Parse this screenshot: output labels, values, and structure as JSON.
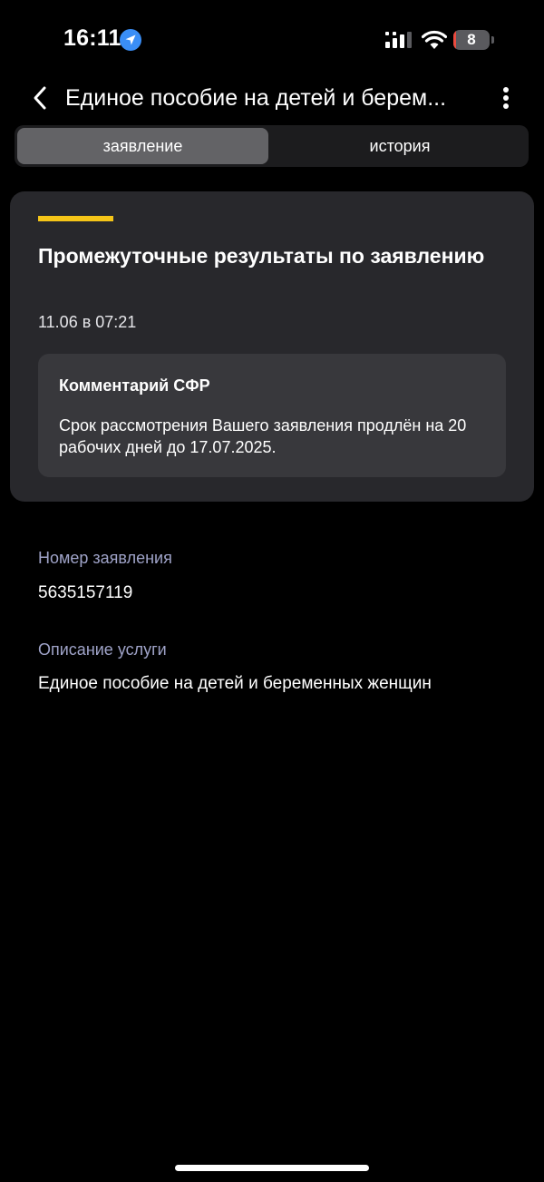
{
  "status_bar": {
    "time": "16:11",
    "battery_level": "8",
    "battery_percent": 8
  },
  "header": {
    "title": "Единое пособие на детей и берем...",
    "back_icon": "chevron-left-icon",
    "more_icon": "vertical-dots-icon"
  },
  "tabs": [
    {
      "label": "заявление",
      "active": true
    },
    {
      "label": "история",
      "active": false
    }
  ],
  "status_card": {
    "accent_color": "#f5c518",
    "title": "Промежуточные результаты по заявлению",
    "date": "11.06 в 07:21",
    "comment": {
      "title": "Комментарий СФР",
      "text": "Срок рассмотрения Вашего заявления продлён на 20 рабочих дней до 17.07.2025."
    }
  },
  "details": [
    {
      "label": "Номер заявления",
      "value": "5635157119"
    },
    {
      "label": "Описание услуги",
      "value": "Единое пособие на детей и беременных женщин"
    }
  ]
}
